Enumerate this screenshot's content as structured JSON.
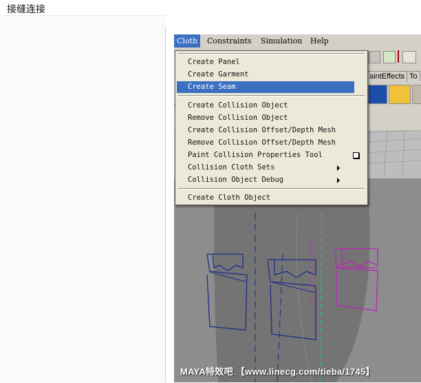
{
  "page": {
    "title": "接缝连接"
  },
  "menubar": {
    "items": [
      "Cloth",
      "Constraints",
      "Simulation",
      "Help"
    ],
    "active": "Cloth"
  },
  "shelf": {
    "tabs": [
      "aintEffects",
      "To"
    ]
  },
  "menu": {
    "items": [
      {
        "label": "Create Panel"
      },
      {
        "label": "Create Garment"
      },
      {
        "label": "Create Seam",
        "highlighted": true
      },
      {
        "label": "Create Collision Object"
      },
      {
        "label": "Remove Collision Object"
      },
      {
        "label": "Create Collision Offset/Depth Mesh"
      },
      {
        "label": "Remove Collision Offset/Depth Mesh"
      },
      {
        "label": "Paint Collision Properties Tool",
        "option_box": true
      },
      {
        "label": "Collision Cloth Sets",
        "submenu": true
      },
      {
        "label": "Collision Object Debug",
        "submenu": true
      },
      {
        "label": "Create Cloth Object"
      }
    ]
  },
  "watermark": {
    "text": "MAYA特效吧 【www.linecg.com/tieba/1745】"
  },
  "colors": {
    "highlight": "#3b6fc2",
    "menu_bg": "#ece9d8",
    "viewport_bg": "#8d8d8d",
    "panel_blue": "#1e2a8c",
    "panel_magenta": "#c020c0"
  }
}
